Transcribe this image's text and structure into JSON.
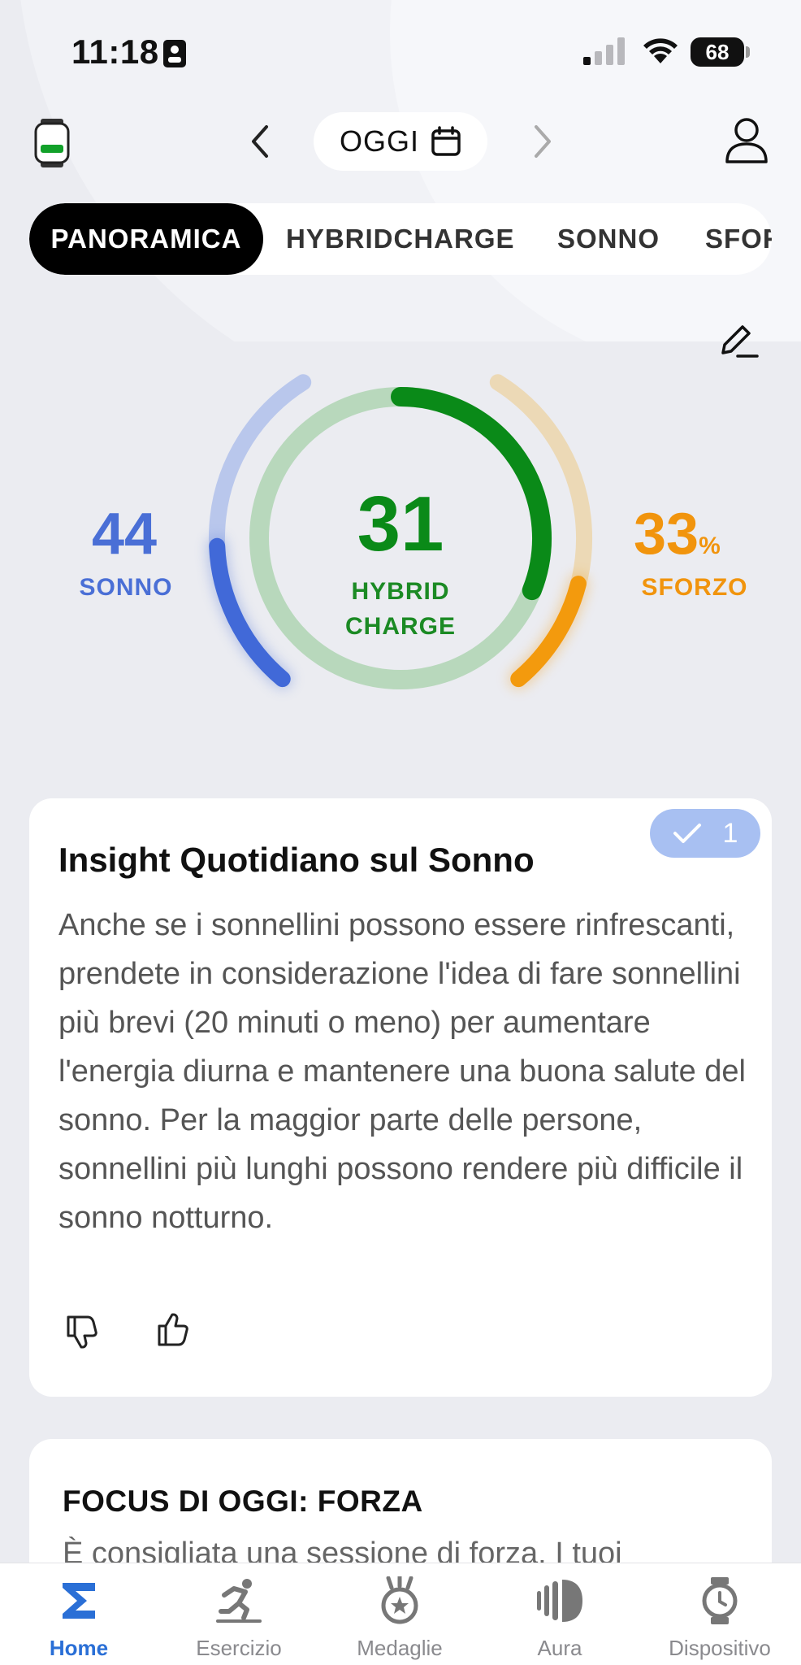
{
  "status_bar": {
    "time": "11:18",
    "battery": "68"
  },
  "header": {
    "date_label": "OGGI"
  },
  "tabs": [
    {
      "label": "PANORAMICA",
      "active": true
    },
    {
      "label": "HYBRIDCHARGE",
      "active": false
    },
    {
      "label": "SONNO",
      "active": false
    },
    {
      "label": "SFORZO",
      "active": false
    }
  ],
  "gauge": {
    "sonno": {
      "value": "44",
      "label": "SONNO",
      "level": 0.44,
      "color": "#4a6fd6"
    },
    "hybrid_charge": {
      "value": "31",
      "label_line1": "HYBRID",
      "label_line2": "CHARGE",
      "level": 0.31,
      "color": "#0a8a18"
    },
    "sforzo": {
      "value": "33",
      "unit": "%",
      "label": "SFORZO",
      "level": 0.33,
      "color": "#f1940d"
    }
  },
  "insight_card": {
    "badge_count": "1",
    "title": "Insight Quotidiano sul Sonno",
    "body": "Anche se i sonnellini possono essere rinfrescanti, prendete in considerazione l'idea di fare sonnellini più brevi (20 minuti o meno) per aumentare l'energia diurna e mantenere una buona salute del sonno. Per la maggior parte delle persone, sonnellini più lunghi possono rendere più difficile il sonno notturno."
  },
  "focus_card": {
    "title": "FOCUS DI OGGI: FORZA",
    "body": "È consigliata una sessione di forza. I tuoi"
  },
  "bottom_nav": [
    {
      "label": "Home",
      "icon": "sigma-icon",
      "active": true
    },
    {
      "label": "Esercizio",
      "icon": "runner-icon",
      "active": false
    },
    {
      "label": "Medaglie",
      "icon": "medal-icon",
      "active": false
    },
    {
      "label": "Aura",
      "icon": "aura-icon",
      "active": false
    },
    {
      "label": "Dispositivo",
      "icon": "watch-icon",
      "active": false
    }
  ],
  "colors": {
    "accent_blue": "#2a6fd6",
    "green": "#0a8a18",
    "orange": "#f1940d",
    "background": "#ebecf1"
  }
}
